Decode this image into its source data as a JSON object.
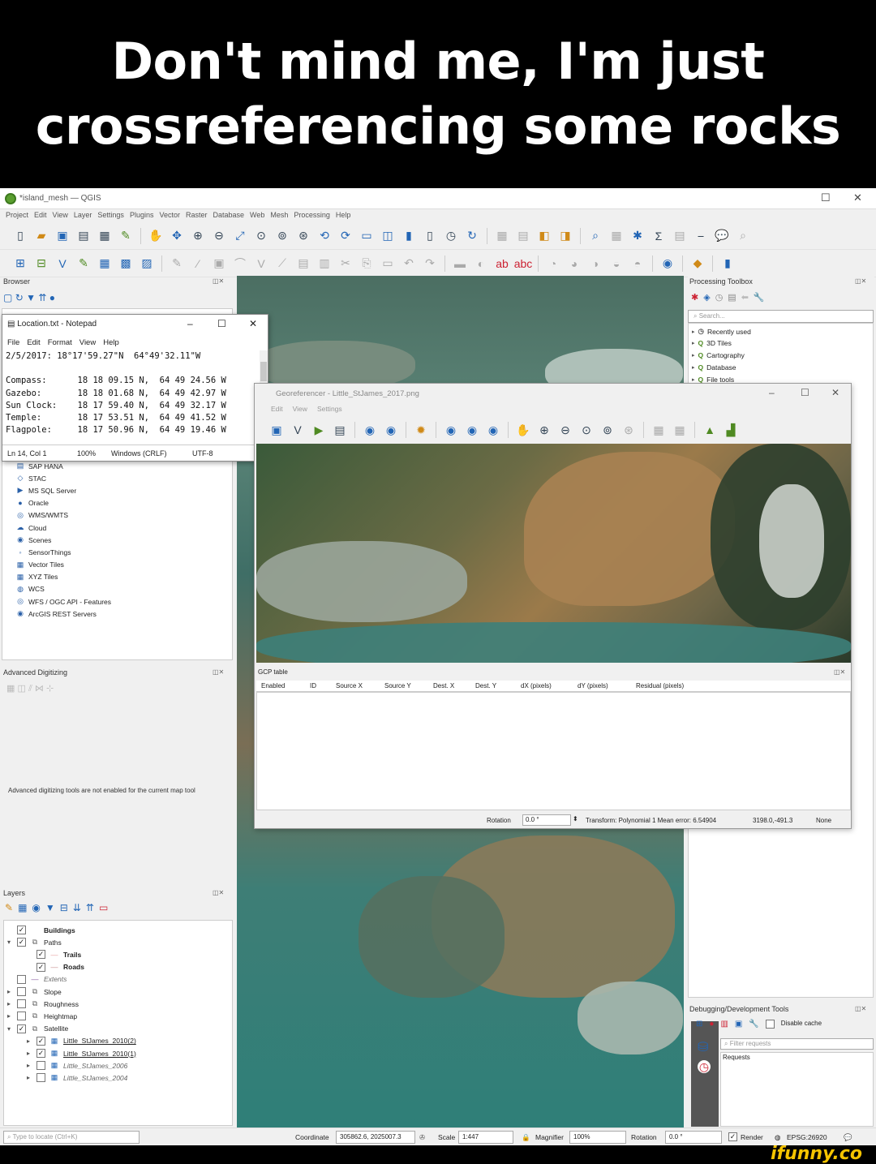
{
  "meme": {
    "line1": "Don't mind me, I'm just",
    "line2": "crossreferencing some rocks",
    "watermark": "ifunny.co"
  },
  "qgis": {
    "window_title": "*island_mesh — QGIS",
    "menu": [
      "Project",
      "Edit",
      "View",
      "Layer",
      "Settings",
      "Plugins",
      "Vector",
      "Raster",
      "Database",
      "Web",
      "Mesh",
      "Processing",
      "Help"
    ],
    "browser": {
      "title": "Browser",
      "items": [
        {
          "icon": "sap-hana-icon",
          "glyph": "▤",
          "label": "SAP HANA"
        },
        {
          "icon": "stac-icon",
          "glyph": "◇",
          "label": "STAC"
        },
        {
          "icon": "mssql-icon",
          "glyph": "▶",
          "label": "MS SQL Server"
        },
        {
          "icon": "oracle-icon",
          "glyph": "●",
          "label": "Oracle"
        },
        {
          "icon": "wms-icon",
          "glyph": "◎",
          "label": "WMS/WMTS"
        },
        {
          "icon": "cloud-icon",
          "glyph": "☁",
          "label": "Cloud"
        },
        {
          "icon": "scenes-icon",
          "glyph": "◉",
          "label": "Scenes"
        },
        {
          "icon": "sensorthings-icon",
          "glyph": "◦",
          "label": "SensorThings"
        },
        {
          "icon": "vector-tiles-icon",
          "glyph": "▦",
          "label": "Vector Tiles"
        },
        {
          "icon": "xyz-tiles-icon",
          "glyph": "▦",
          "label": "XYZ Tiles"
        },
        {
          "icon": "wcs-icon",
          "glyph": "◍",
          "label": "WCS"
        },
        {
          "icon": "wfs-icon",
          "glyph": "◎",
          "label": "WFS / OGC API - Features"
        },
        {
          "icon": "arcgis-icon",
          "glyph": "◉",
          "label": "ArcGIS REST Servers"
        }
      ]
    },
    "advanced_digitizing": {
      "title": "Advanced Digitizing",
      "message": "Advanced digitizing tools are not enabled for the current map tool"
    },
    "layers": {
      "title": "Layers",
      "items": [
        {
          "label": "Buildings",
          "checked": true,
          "style": "bold",
          "indent": 1,
          "expander": ""
        },
        {
          "label": "Paths",
          "checked": true,
          "style": "group",
          "indent": 1,
          "expander": "▾"
        },
        {
          "label": "Trails",
          "checked": true,
          "style": "bold",
          "indent": 2,
          "expander": "",
          "swatch": "#e8a0a0"
        },
        {
          "label": "Roads",
          "checked": true,
          "style": "bold",
          "indent": 2,
          "expander": "",
          "swatch": "#c89090"
        },
        {
          "label": "Extents",
          "checked": false,
          "style": "ital",
          "indent": 1,
          "expander": "",
          "swatch": "#8a5aa0"
        },
        {
          "label": "Slope",
          "checked": false,
          "style": "group",
          "indent": 1,
          "expander": "▸"
        },
        {
          "label": "Roughness",
          "checked": false,
          "style": "group",
          "indent": 1,
          "expander": "▸"
        },
        {
          "label": "Heightmap",
          "checked": false,
          "style": "group",
          "indent": 1,
          "expander": "▸"
        },
        {
          "label": "Satellite",
          "checked": true,
          "style": "group",
          "indent": 1,
          "expander": "▾"
        },
        {
          "label": "Little_StJames_2010(2)",
          "checked": true,
          "style": "under",
          "indent": 2,
          "expander": "▸"
        },
        {
          "label": "Little_StJames_2010(1)",
          "checked": true,
          "style": "under",
          "indent": 2,
          "expander": "▸"
        },
        {
          "label": "Little_StJames_2006",
          "checked": false,
          "style": "ital",
          "indent": 2,
          "expander": "▸"
        },
        {
          "label": "Little_StJames_2004",
          "checked": false,
          "style": "ital",
          "indent": 2,
          "expander": "▸"
        }
      ]
    },
    "processing": {
      "title": "Processing Toolbox",
      "search_placeholder": "Search...",
      "items": [
        "Recently used",
        "3D Tiles",
        "Cartography",
        "Database",
        "File tools"
      ]
    },
    "debug": {
      "title": "Debugging/Development Tools",
      "disable_cache": "Disable cache",
      "filter_placeholder": "Filter requests",
      "requests_label": "Requests"
    },
    "statusbar": {
      "locate_placeholder": "Type to locate (Ctrl+K)",
      "coordinate_label": "Coordinate",
      "coordinate_value": "305862.6, 2025007.3",
      "scale_label": "Scale",
      "scale_value": "1:447",
      "magnifier_label": "Magnifier",
      "magnifier_value": "100%",
      "rotation_label": "Rotation",
      "rotation_value": "0.0 °",
      "render_label": "Render",
      "crs_label": "EPSG:26920"
    }
  },
  "notepad": {
    "title": "Location.txt - Notepad",
    "menu": [
      "File",
      "Edit",
      "Format",
      "View",
      "Help"
    ],
    "text": "2/5/2017: 18°17'59.27\"N  64°49'32.11\"W\n\nCompass:      18 18 09.15 N,  64 49 24.56 W\nGazebo:       18 18 01.68 N,  64 49 42.97 W\nSun Clock:    18 17 59.40 N,  64 49 32.17 W\nTemple:       18 17 53.51 N,  64 49 41.52 W\nFlagpole:     18 17 50.96 N,  64 49 19.46 W",
    "status_pos": "Ln 14, Col 1",
    "status_zoom": "100%",
    "status_eol": "Windows (CRLF)",
    "status_enc": "UTF-8"
  },
  "georeferencer": {
    "title": "Georeferencer - Little_StJames_2017.png",
    "menu": [
      "Edit",
      "View",
      "Settings"
    ],
    "gcp_title": "GCP table",
    "gcp_columns": [
      "Enabled",
      "ID",
      "Source X",
      "Source Y",
      "Dest. X",
      "Dest. Y",
      "dX (pixels)",
      "dY (pixels)",
      "Residual (pixels)"
    ],
    "rotation_label": "Rotation",
    "rotation_value": "0.0 °",
    "transform_text": "Transform: Polynomial 1 Mean error: 6.54904",
    "coords_text": "3198.0,-491.3",
    "none_text": "None"
  }
}
